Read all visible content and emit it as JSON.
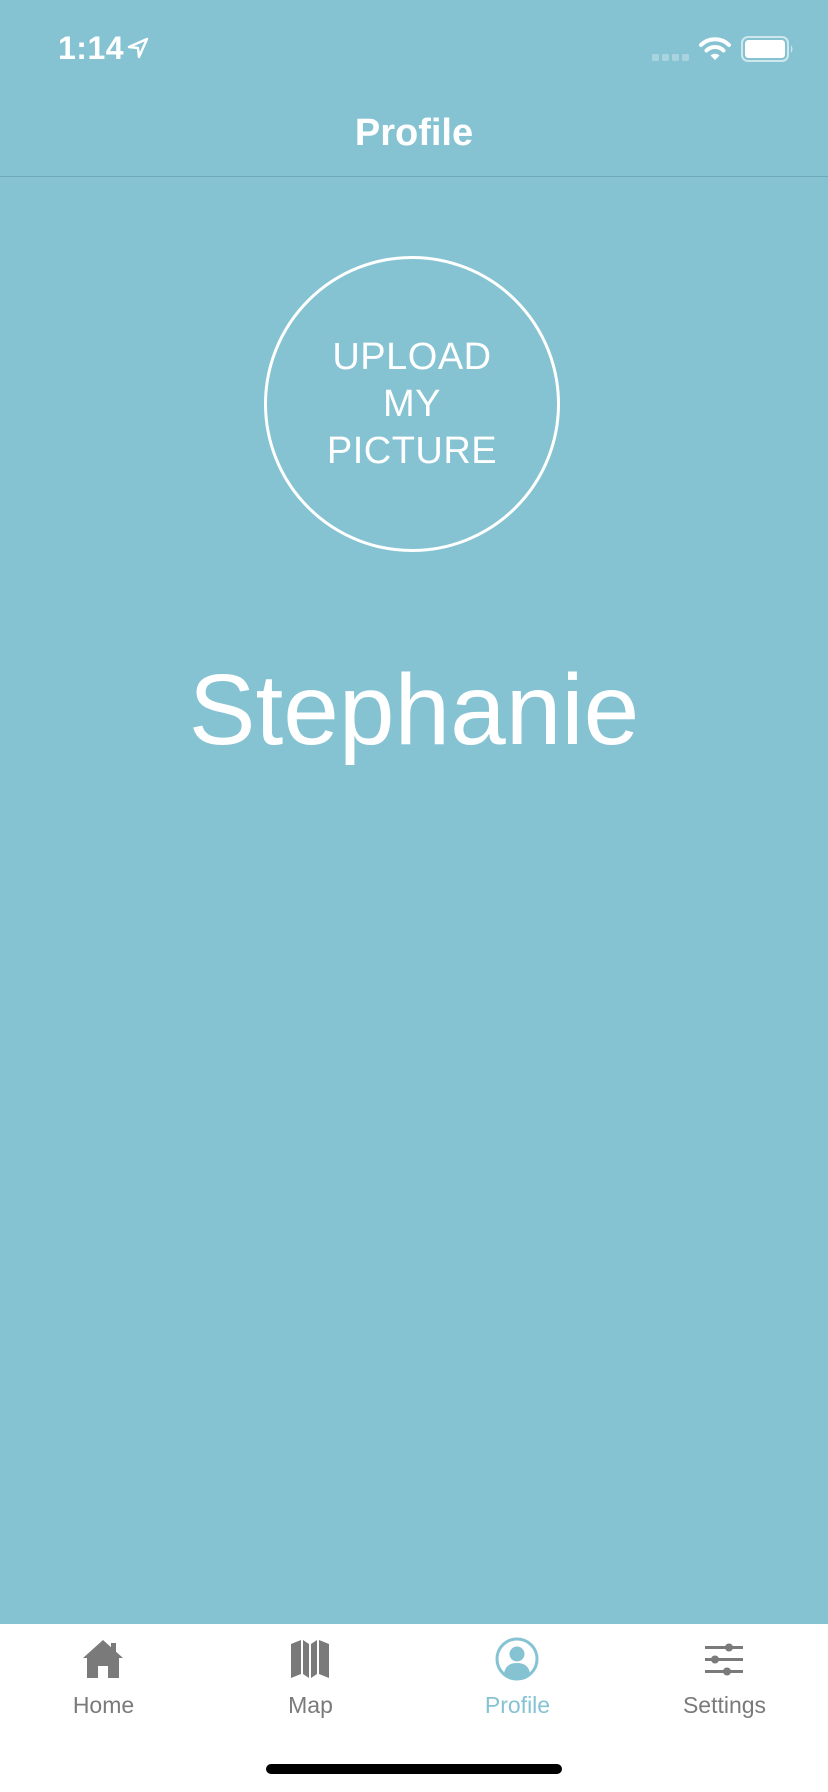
{
  "status_bar": {
    "time": "1:14"
  },
  "nav": {
    "title": "Profile"
  },
  "profile": {
    "upload_label": "UPLOAD MY PICTURE",
    "name": "Stephanie"
  },
  "tabs": [
    {
      "label": "Home",
      "icon": "home-icon",
      "active": false
    },
    {
      "label": "Map",
      "icon": "map-icon",
      "active": false
    },
    {
      "label": "Profile",
      "icon": "profile-icon",
      "active": true
    },
    {
      "label": "Settings",
      "icon": "settings-icon",
      "active": false
    }
  ],
  "colors": {
    "background": "#85c3d3",
    "accent": "#85c3d3",
    "inactive_tab": "#7a7a7a",
    "text_on_background": "#ffffff"
  }
}
